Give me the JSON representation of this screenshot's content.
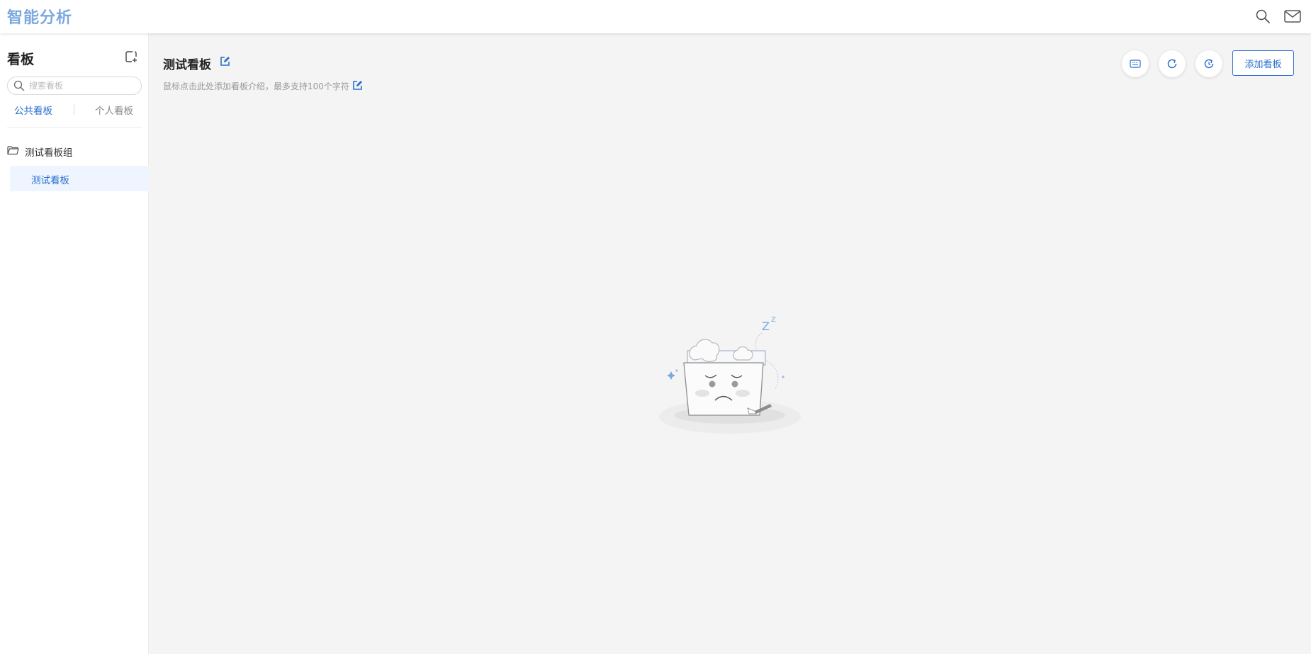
{
  "header": {
    "app_title": "智能分析",
    "icons": [
      "search-icon",
      "mail-icon"
    ]
  },
  "sidebar": {
    "title": "看板",
    "search": {
      "placeholder": "搜索看板",
      "value": ""
    },
    "tabs": [
      {
        "label": "公共看板",
        "active": true
      },
      {
        "label": "个人看板",
        "active": false
      }
    ],
    "groups": [
      {
        "label": "测试看板组",
        "icon": "folder-icon",
        "boards": [
          {
            "label": "测试看板",
            "selected": true
          }
        ]
      }
    ]
  },
  "main": {
    "board_title": "测试看板",
    "description": "鼠标点击此处添加看板介绍，最多支持100个字符",
    "toolbar": {
      "icons": [
        "screen-icon",
        "refresh-icon",
        "auto-refresh-icon"
      ],
      "add_label": "添加看板"
    },
    "empty_state": {
      "illustration": "sleeping-box-illustration"
    }
  },
  "colors": {
    "accent": "#2b6fce",
    "title": "#7aa8df",
    "selected_bg": "#eef5ff",
    "page_bg": "#f4f4f4"
  }
}
